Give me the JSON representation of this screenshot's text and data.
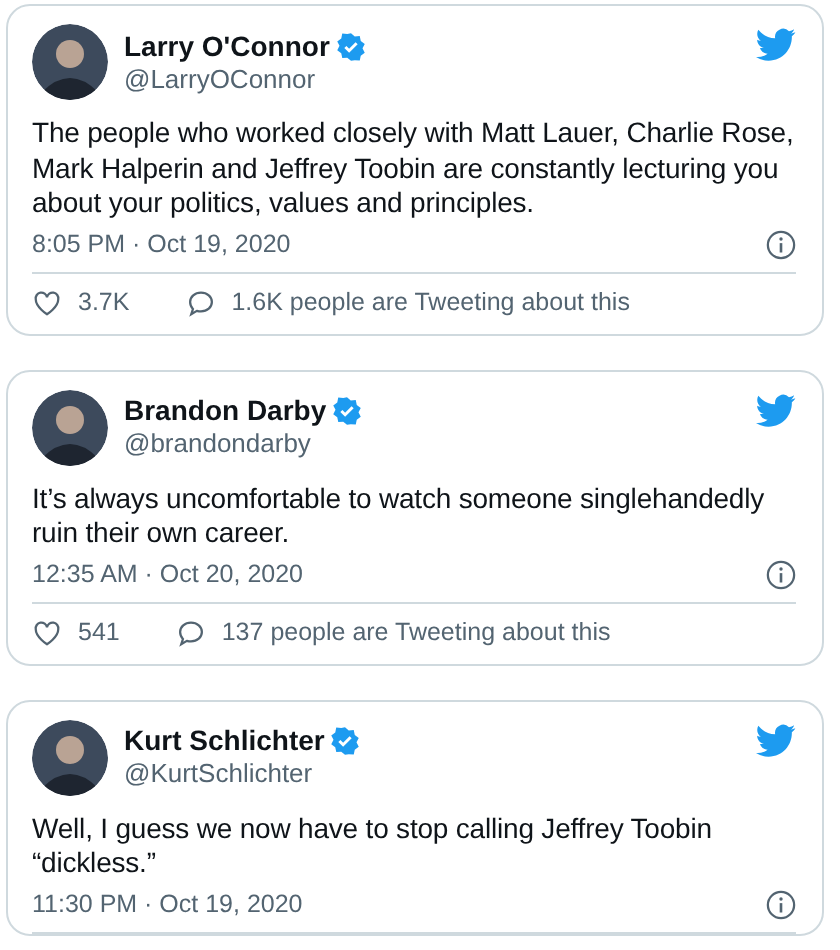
{
  "tweets": [
    {
      "name": "Larry O'Connor",
      "verified": true,
      "handle": "@LarryOConnor",
      "text": "The people who worked closely with Matt Lauer, Charlie Rose, Mark Halperin and Jeffrey Toobin are constantly lecturing you about your politics, values and principles.",
      "time": "8:05 PM · Oct 19, 2020",
      "likes": "3.7K",
      "talking": "1.6K people are Tweeting about this"
    },
    {
      "name": "Brandon Darby",
      "verified": true,
      "handle": "@brandondarby",
      "text": "It’s always uncomfortable to watch someone singlehandedly ruin their own career.",
      "time": "12:35 AM · Oct 20, 2020",
      "likes": "541",
      "talking": "137 people are Tweeting about this"
    },
    {
      "name": "Kurt Schlichter",
      "verified": true,
      "handle": "@KurtSchlichter",
      "text": "Well, I guess we now have to stop calling Jeffrey Toobin “dickless.”",
      "time": "11:30 PM · Oct 19, 2020"
    }
  ]
}
